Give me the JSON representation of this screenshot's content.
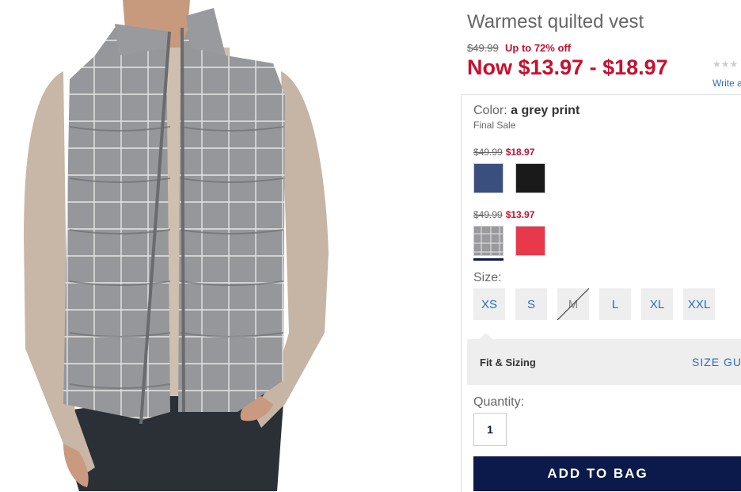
{
  "product": {
    "title": "Warmest quilted vest",
    "original_price": "$49.99",
    "discount_text": "Up to 72% off",
    "now_price": "Now $13.97 - $18.97",
    "rating_stars": "★★★",
    "write_review": "Write a"
  },
  "color": {
    "label": "Color:",
    "value": "a grey print",
    "note": "Final Sale",
    "groups": [
      {
        "old_price": "$49.99",
        "new_price": "$18.97",
        "swatches": [
          {
            "name": "navy",
            "color": "#3b4f7e"
          },
          {
            "name": "black",
            "color": "#1a1a1a"
          }
        ]
      },
      {
        "old_price": "$49.99",
        "new_price": "$13.97",
        "swatches": [
          {
            "name": "grey print",
            "color": "#9a9a9c",
            "selected": true
          },
          {
            "name": "red",
            "color": "#e8394a"
          }
        ]
      }
    ]
  },
  "size": {
    "label": "Size:",
    "options": [
      "XS",
      "S",
      "M",
      "L",
      "XL",
      "XXL"
    ],
    "unavailable": [
      "M"
    ]
  },
  "fit": {
    "label": "Fit & Sizing",
    "guide": "SIZE GUI"
  },
  "quantity": {
    "label": "Quantity:",
    "value": "1"
  },
  "cta": {
    "add_to_bag": "ADD TO BAG"
  },
  "colors": {
    "sale_red": "#c8102e",
    "link_blue": "#2a6ebb",
    "navy": "#0b1a4a"
  }
}
